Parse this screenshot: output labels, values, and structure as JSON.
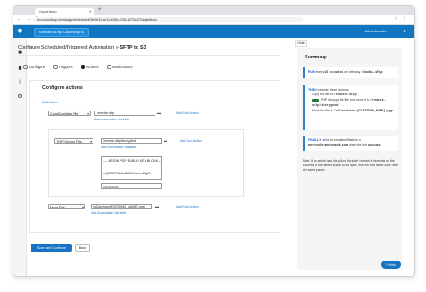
{
  "browser": {
    "tab_title": "Couchdrop",
    "url": "my.couchdrop.io/manage/scheduled/08e9b15-ac7c-4064-8782-8270c272dd/settings"
  },
  "header": {
    "connect_label": "Connect to my Couchdrop io",
    "admin_label": "Administration"
  },
  "breadcrumb": {
    "parent": "Configure Scheduled/Triggered Automation",
    "current": "SFTP to S3"
  },
  "steps": [
    {
      "label": "Configure",
      "selected": false
    },
    {
      "label": "Triggers",
      "selected": false
    },
    {
      "label": "Actions",
      "selected": true
    },
    {
      "label": "Notifications",
      "selected": false
    }
  ],
  "actions": {
    "title": "Configure Actions",
    "add_action": "Add Action",
    "rows": [
      {
        "type": "Copy/Duplicate File",
        "path": "/remote-sftp",
        "add_sub_action": "Add Sub Action",
        "add_automation_variable": "Add Automation Variable"
      },
      {
        "type": "PGP Decrypt File",
        "path": "/remote-sftp/decrypted",
        "add_sub_action": "Add Sub Action",
        "add_automation_variable": "Add Automation Variable",
        "key_text": "-----BEGIN PGP PUBLIC KEY BLOCK----\n\nmQINBFRiAKcBEACcx6rerZzyZr",
        "password_mask": "••••••••••••"
      },
      {
        "type": "Move File",
        "path": "/s3/archive/{EXISTING_NAME}.pgp",
        "add_sub_action": "Add Sub Action",
        "add_automation_variable": "Add Automation Variable"
      }
    ]
  },
  "buttons": {
    "save": "Save and Continue",
    "back": "Back"
  },
  "summary": {
    "hide_label": "Hide",
    "title": "Summary",
    "run_kw": "RUN",
    "run_text": "every",
    "run_interval": "15 minutes",
    "run_text2": "on directory",
    "run_dir": "/bombi-sftp",
    "then_kw": "THEN",
    "then_text": "execute these actions:",
    "then_copy_text": "Copy the file to",
    "then_copy_dir": "/remote-sftp",
    "then_decrypt_text": "PGP decrypt the file and move it to",
    "then_decrypt_dir": "/remote-sftp/decrypted",
    "then_move_text": "Move the file to",
    "then_move_dir": "/s3/archive/{EXISTING_NAME}.pgp",
    "finally_kw": "FINALLY",
    "finally_text": "send an email notification to",
    "finally_email": "person@remotebank.com",
    "finally_text2": "when the job",
    "finally_status": "success",
    "note": "Note: If an action has this pill on the side it means it depends on the success of the parent action so its input. Pills with the same color have the same parent."
  },
  "help_label": "Help",
  "colors": {
    "header_blue": "#0f76c2",
    "primary_button": "#1673c4",
    "link": "#1a73c9",
    "pill_green": "#1f7a3a"
  }
}
